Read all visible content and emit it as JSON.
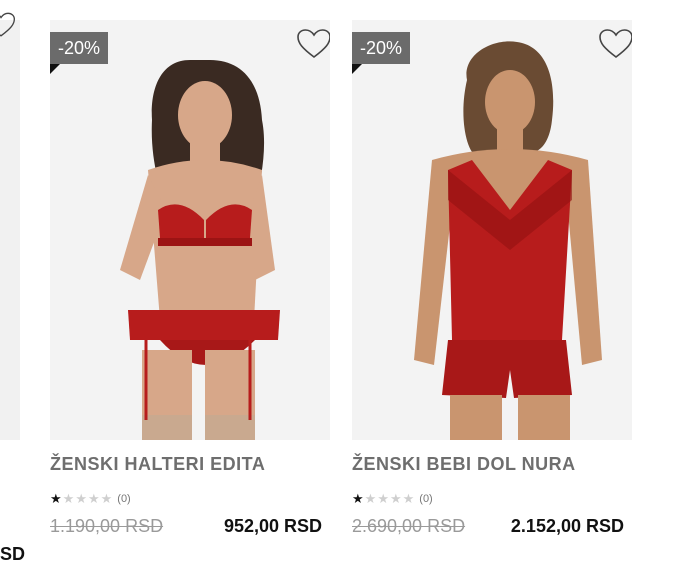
{
  "products": [
    {
      "badge": "-20%",
      "name": "ŽENSKI HALTERI EDITA",
      "rating_count": "(0)",
      "old_price": "1.190,00 RSD",
      "new_price": "952,00 RSD"
    },
    {
      "badge": "-20%",
      "name": "ŽENSKI BEBI DOL NURA",
      "rating_count": "(0)",
      "old_price": "2.690,00 RSD",
      "new_price": "2.152,00 RSD"
    }
  ],
  "partial_price": "SD",
  "colors": {
    "badge_bg": "#6b6b6b",
    "product_red": "#b71c1c",
    "title_gray": "#6e6e6e"
  },
  "icons": [
    "heart-outline-icon",
    "star-icon"
  ]
}
